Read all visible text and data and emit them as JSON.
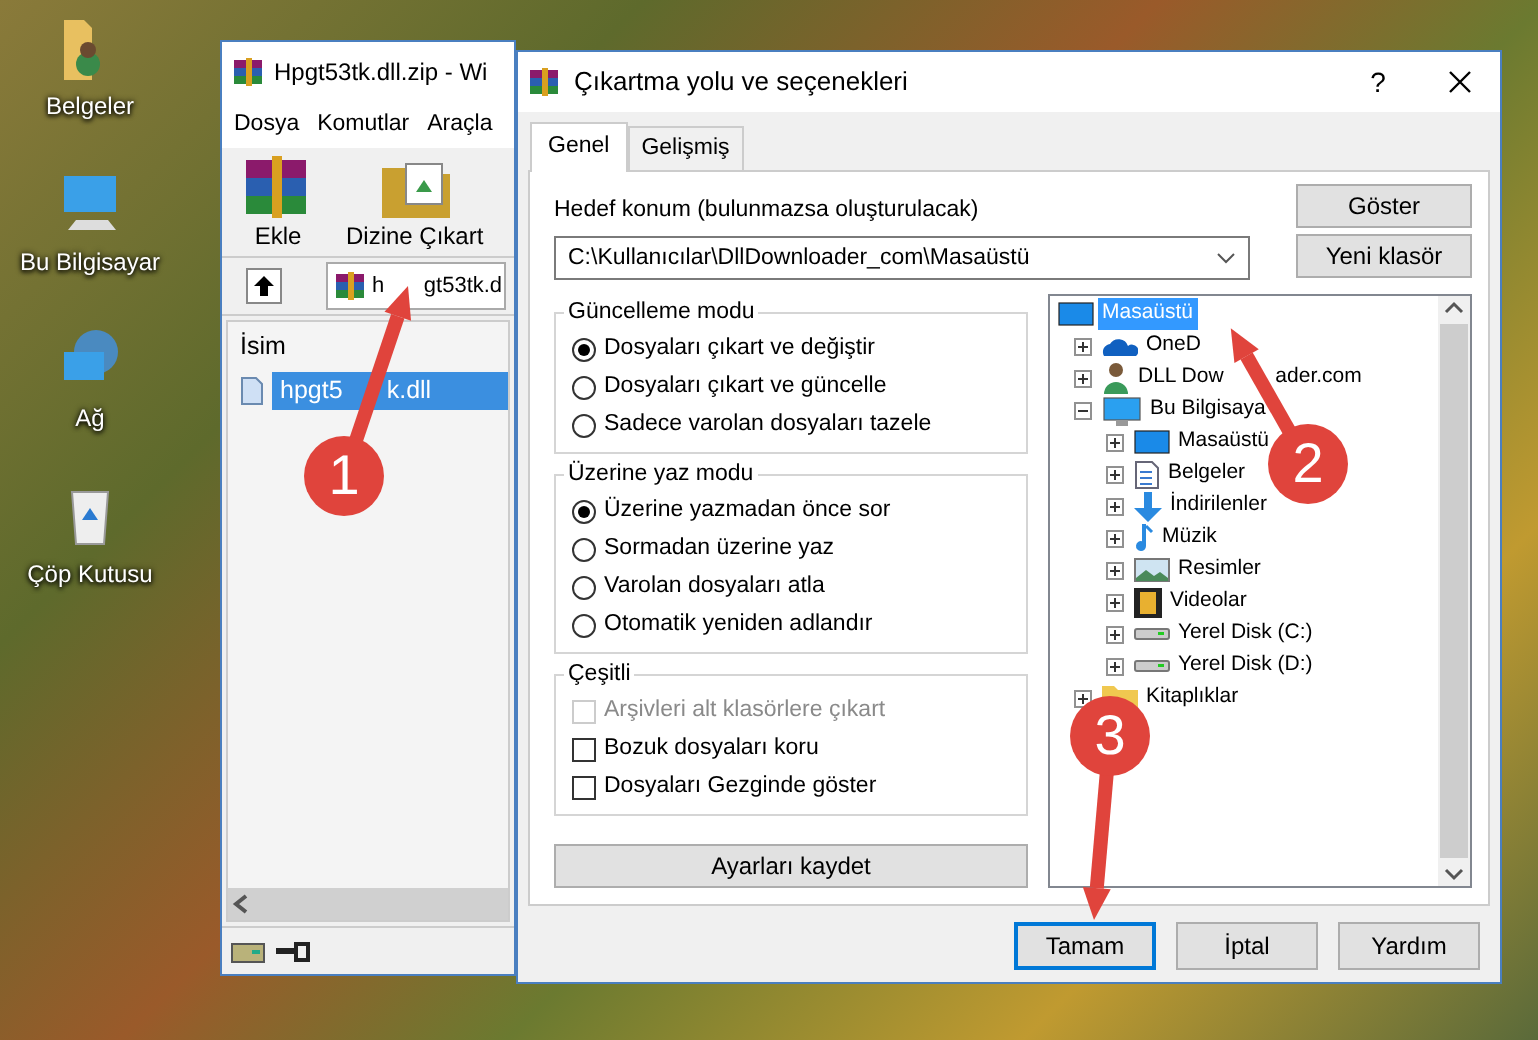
{
  "desktop": {
    "icons": [
      {
        "label": "Belgeler",
        "kind": "documents"
      },
      {
        "label": "Bu Bilgisayar",
        "kind": "computer"
      },
      {
        "label": "Ağ",
        "kind": "network"
      },
      {
        "label": "Çöp Kutusu",
        "kind": "recycle"
      }
    ]
  },
  "archive_window": {
    "title": "Hpgt53tk.dll.zip - Wi",
    "menu": [
      "Dosya",
      "Komutlar",
      "Araçla"
    ],
    "toolbar": [
      {
        "label": "Ekle",
        "kind": "add"
      },
      {
        "label": "Dizine Çıkart",
        "kind": "extract"
      }
    ],
    "path": "h",
    "path_after": "gt53tk.d",
    "columns": [
      "İsim"
    ],
    "files": [
      {
        "name": "hpgt5",
        "name_after": "k.dll",
        "selected": true
      }
    ]
  },
  "dialog": {
    "title": "Çıkartma yolu ve seçenekleri",
    "help": "?",
    "tabs": [
      {
        "label": "Genel",
        "selected": true
      },
      {
        "label": "Gelişmiş",
        "selected": false
      }
    ],
    "destination": {
      "label": "Hedef konum (bulunmazsa oluşturulacak)",
      "value": "C:\\Kullanıcılar\\DllDownloader_com\\Masaüstü"
    },
    "side_buttons": [
      "Göster",
      "Yeni klasör"
    ],
    "groups": [
      {
        "title": "Güncelleme modu",
        "kind": "radio",
        "options": [
          {
            "label": "Dosyaları çıkart ve değiştir",
            "selected": true
          },
          {
            "label": "Dosyaları çıkart ve güncelle",
            "selected": false
          },
          {
            "label": "Sadece varolan dosyaları tazele",
            "selected": false
          }
        ]
      },
      {
        "title": "Üzerine yaz modu",
        "kind": "radio",
        "options": [
          {
            "label": "Üzerine yazmadan önce sor",
            "selected": true
          },
          {
            "label": "Sormadan üzerine yaz",
            "selected": false
          },
          {
            "label": "Varolan dosyaları atla",
            "selected": false
          },
          {
            "label": "Otomatik yeniden adlandır",
            "selected": false
          }
        ]
      },
      {
        "title": "Çeşitli",
        "kind": "checkbox",
        "options": [
          {
            "label": "Arşivleri alt klasörlere çıkart",
            "checked": false,
            "disabled": true
          },
          {
            "label": "Bozuk dosyaları koru",
            "checked": false,
            "disabled": false
          },
          {
            "label": "Dosyaları Gezginde göster",
            "checked": false,
            "disabled": false
          }
        ]
      }
    ],
    "save_button": "Ayarları kaydet",
    "tree": {
      "root": {
        "label": "Masaüstü",
        "kind": "desktop",
        "selected": true
      },
      "items": [
        {
          "label": "OneD",
          "kind": "cloud",
          "expanded": false,
          "selected": false
        },
        {
          "label": "DLL Dow",
          "label_after": "ader.com",
          "kind": "user",
          "expanded": false,
          "selected": false
        },
        {
          "label": "Bu Bilgisaya",
          "kind": "computer",
          "expanded": true,
          "selected": false,
          "children": [
            {
              "label": "Masaüstü",
              "kind": "desktop",
              "expanded": false,
              "selected": false
            },
            {
              "label": "Belgeler",
              "kind": "document",
              "expanded": false,
              "selected": false
            },
            {
              "label": "İndirilenler",
              "kind": "download",
              "expanded": false,
              "selected": false
            },
            {
              "label": "Müzik",
              "kind": "music",
              "expanded": false,
              "selected": false
            },
            {
              "label": "Resimler",
              "kind": "picture",
              "expanded": false,
              "selected": false
            },
            {
              "label": "Videolar",
              "kind": "film",
              "expanded": false,
              "selected": false
            },
            {
              "label": "Yerel Disk (C:)",
              "kind": "drive",
              "expanded": false,
              "selected": false
            },
            {
              "label": "Yerel Disk (D:)",
              "kind": "drive",
              "expanded": false,
              "selected": false
            }
          ]
        },
        {
          "label": "Kitaplıklar",
          "kind": "folder",
          "expanded": false,
          "selected": false
        }
      ]
    },
    "buttons": [
      {
        "label": "Tamam",
        "default": true
      },
      {
        "label": "İptal",
        "default": false
      },
      {
        "label": "Yardım",
        "default": false
      }
    ]
  },
  "annotations": [
    {
      "number": "1"
    },
    {
      "number": "2"
    },
    {
      "number": "3"
    }
  ]
}
